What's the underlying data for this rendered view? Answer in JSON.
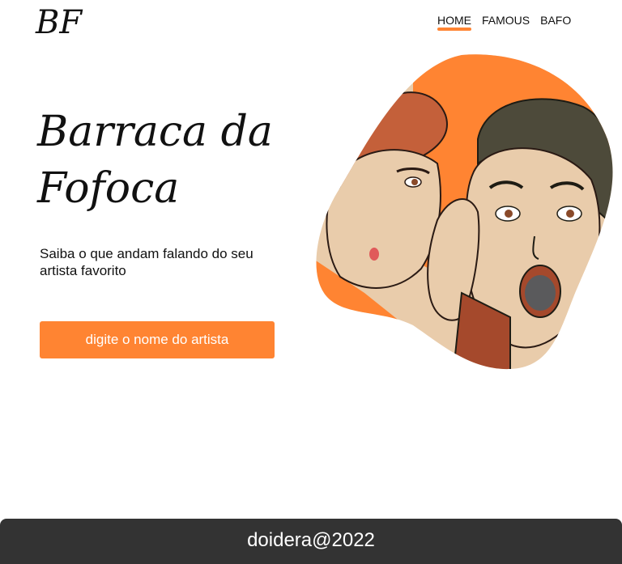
{
  "header": {
    "logo_text": "BF",
    "nav": [
      {
        "label": "HOME",
        "active": true
      },
      {
        "label": "FAMOUS",
        "active": false
      },
      {
        "label": "BAFO",
        "active": false
      }
    ]
  },
  "hero": {
    "title": "Barraca da Fofoca",
    "subtitle": "Saiba o que andam falando do seu artista favorito",
    "search_button": "digite o nome do artista"
  },
  "footer": {
    "text": "doidera@2022"
  },
  "colors": {
    "accent": "#ff8432",
    "footer_bg": "#333333"
  }
}
